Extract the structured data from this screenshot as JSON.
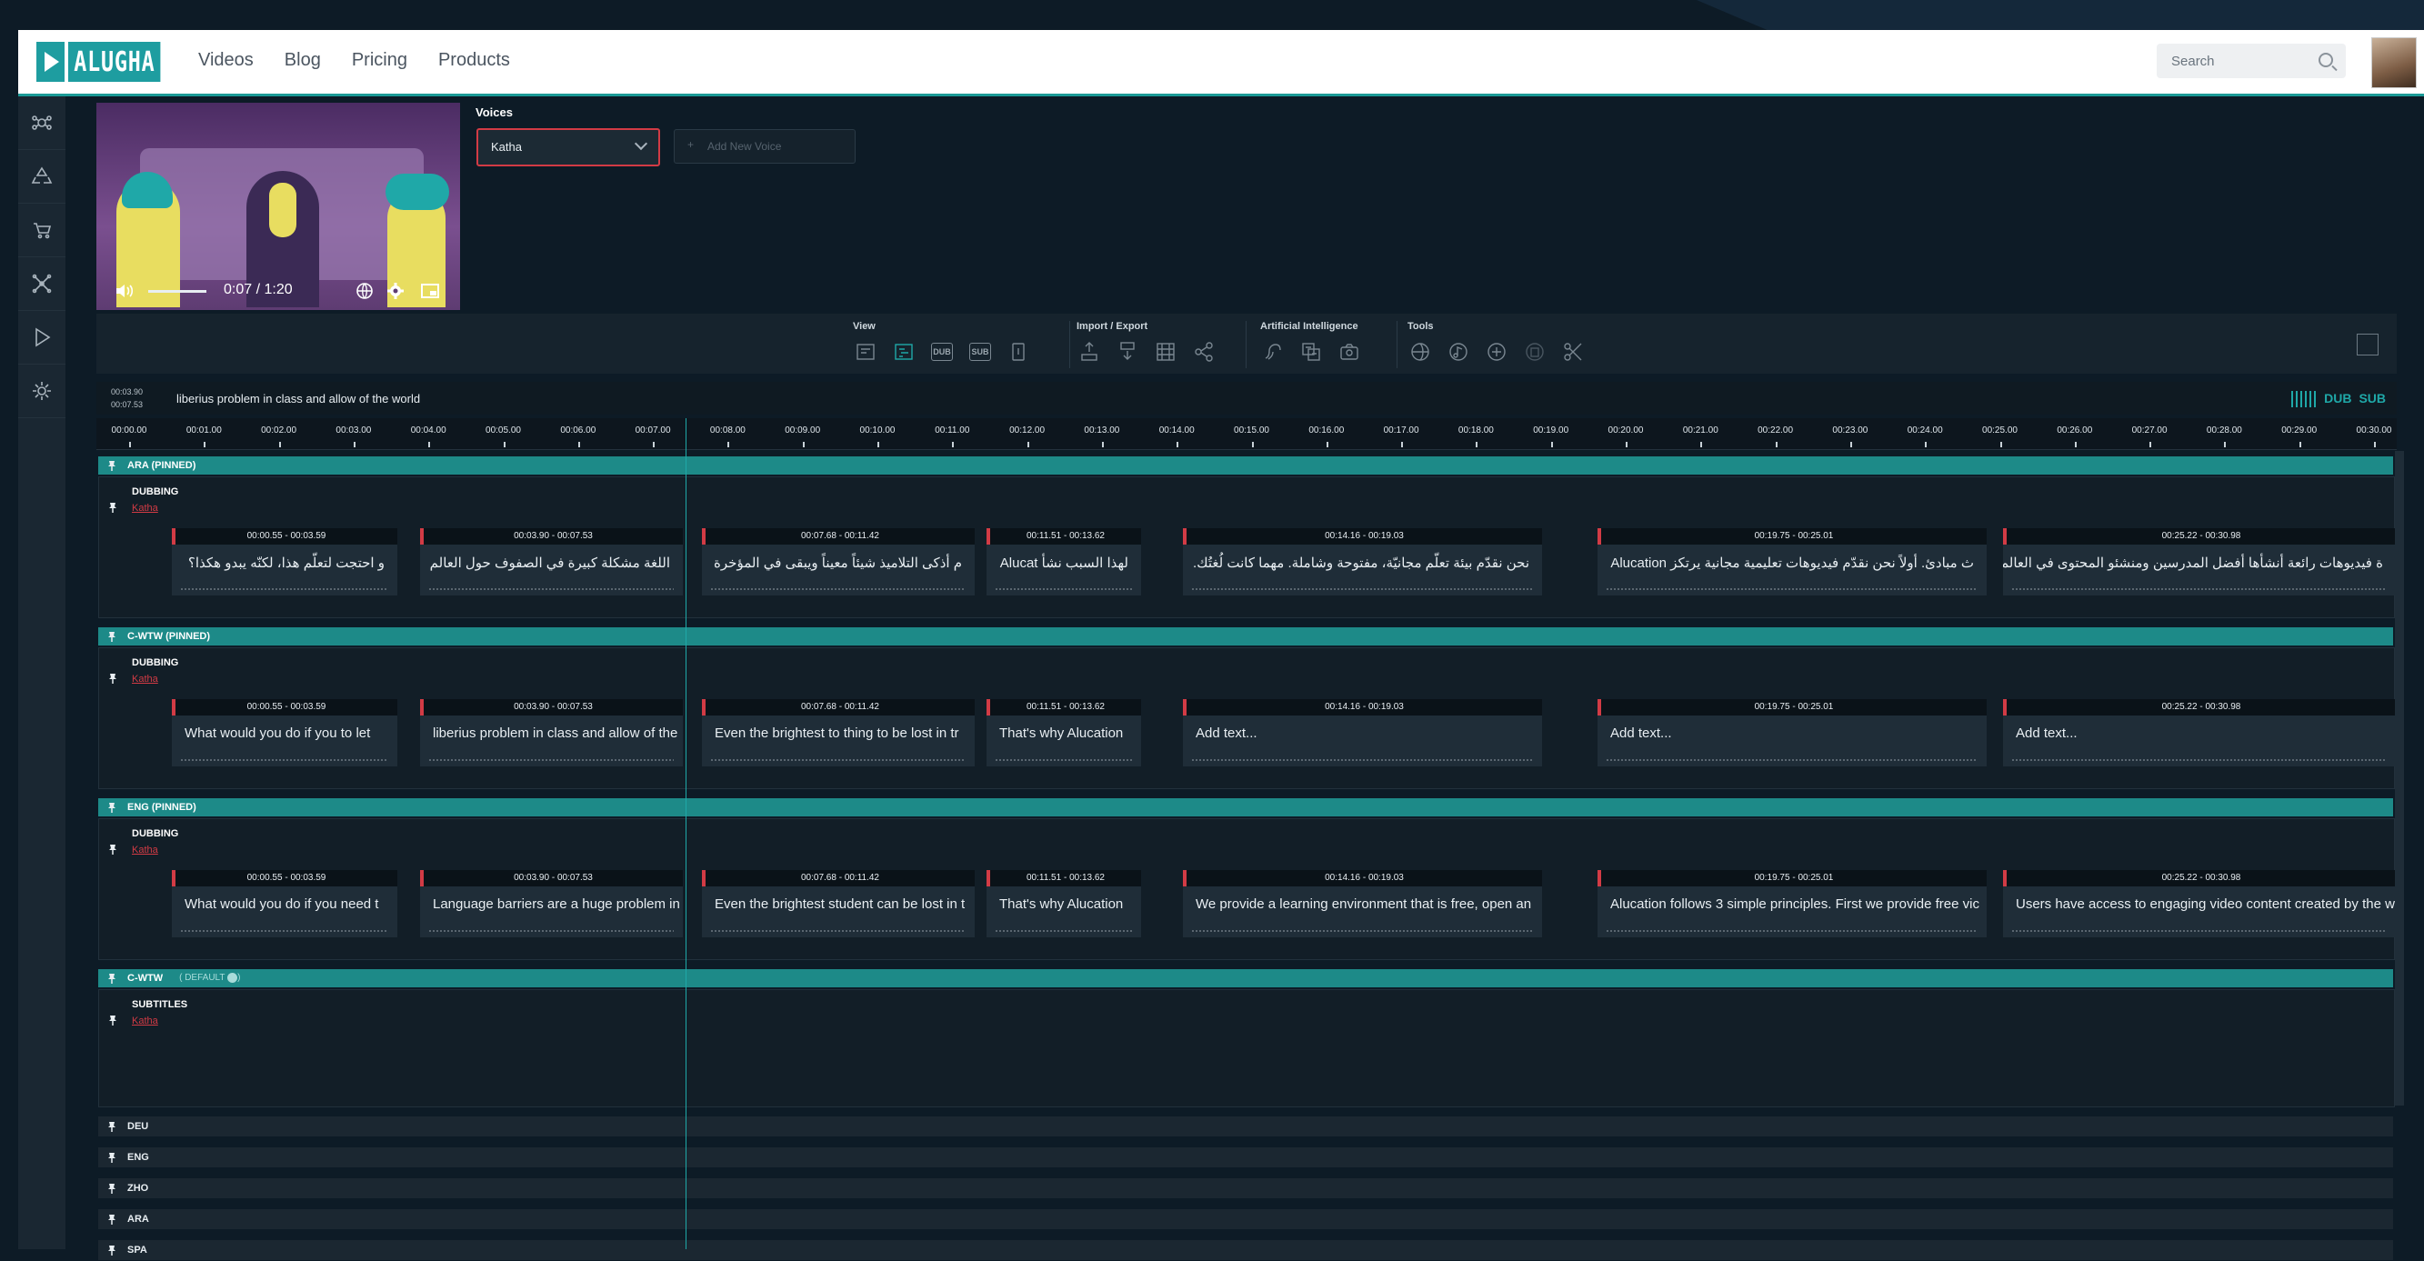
{
  "header": {
    "logo_text": "ALUGHA",
    "nav": [
      "Videos",
      "Blog",
      "Pricing",
      "Products"
    ],
    "search_placeholder": "Search"
  },
  "sidebar": {
    "items": [
      "network-alt-icon",
      "recycle-icon",
      "cart-icon",
      "nodes-icon",
      "play-icon",
      "gear-icon"
    ]
  },
  "video": {
    "time": "0:07 / 1:20"
  },
  "voices": {
    "title": "Voices",
    "selected": "Katha",
    "add_plus": "+",
    "add_label": "Add New Voice"
  },
  "toolbar": {
    "groups": [
      {
        "title": "View",
        "icons": [
          "layout-icon",
          "waveform-view-icon",
          "dub-icon",
          "sub-icon",
          "info-icon"
        ],
        "icon_labels": [
          "",
          "",
          "DUB",
          "SUB",
          ""
        ]
      },
      {
        "title": "Import / Export",
        "icons": [
          "import-icon",
          "sub-download-icon",
          "film-icon",
          "share-icon"
        ]
      },
      {
        "title": "Artificial Intelligence",
        "icons": [
          "ai-voice-icon",
          "ai-translate-icon",
          "ai-camera-icon"
        ]
      },
      {
        "title": "Tools",
        "icons": [
          "globe-tool-icon",
          "music-tool-icon",
          "add-circle-icon",
          "delete-icon",
          "scissors-icon"
        ]
      }
    ]
  },
  "timerow": {
    "start": "00:03.90",
    "end": "00:07.53",
    "text": "liberius problem in class and allow of the world",
    "dub": "DUB",
    "sub": "SUB"
  },
  "ruler": [
    "00:00.00",
    "00:01.00",
    "00:02.00",
    "00:03.00",
    "00:04.00",
    "00:05.00",
    "00:06.00",
    "00:07.00",
    "00:08.00",
    "00:09.00",
    "00:10.00",
    "00:11.00",
    "00:12.00",
    "00:13.00",
    "00:14.00",
    "00:15.00",
    "00:16.00",
    "00:17.00",
    "00:18.00",
    "00:19.00",
    "00:20.00",
    "00:21.00",
    "00:22.00",
    "00:23.00",
    "00:24.00",
    "00:25.00",
    "00:26.00",
    "00:27.00",
    "00:28.00",
    "00:29.00",
    "00:30.00"
  ],
  "segment_times": [
    "00:00.55 - 00:03.59",
    "00:03.90 - 00:07.53",
    "00:07.68 - 00:11.42",
    "00:11.51 - 00:13.62",
    "00:14.16 - 00:19.03",
    "00:19.75 - 00:25.01",
    "00:25.22 - 00:30.98"
  ],
  "tracks": [
    {
      "name": "ARA (PINNED)",
      "type": "DUBBING",
      "voice": "Katha",
      "rtl": true,
      "texts": [
        "و احتجت لتعلّم هذا، لكنّه يبدو هكذا؟",
        "اللغة مشكلة كبيرة في الصفوف حول العالم",
        "م أذكى التلاميذ شيئاً معيناً ويبقى في المؤخرة",
        "لهذا السبب نشأ Alucat",
        "نحن نقدّم بيئة تعلّم مجانيّة، مفتوحة وشاملة. مهما كانت لُغتُك.",
        "ث مبادئ. أولاً نحن نقدّم فيديوهات تعليمية مجانية يرتكز Alucation",
        "ة فيديوهات رائعة أنشأها أفضل المدرسين ومنشئو المحتوى في العالم"
      ]
    },
    {
      "name": "C-WTW (PINNED)",
      "type": "DUBBING",
      "voice": "Katha",
      "rtl": false,
      "texts": [
        "What would you do if you to let",
        "liberius problem in class and allow of the",
        "Even the brightest to thing to be lost in tr",
        "That's why Alucation",
        "Add text...",
        "Add text...",
        "Add text..."
      ]
    },
    {
      "name": "ENG (PINNED)",
      "type": "DUBBING",
      "voice": "Katha",
      "rtl": false,
      "texts": [
        "What would you do if you need t",
        "Language barriers are a huge problem in",
        "Even the brightest student can be lost in t",
        "That's why Alucation",
        "We provide a learning environment that is free, open an",
        "Alucation follows 3 simple principles. First we provide free vic",
        "Users have access to engaging video content created by the world"
      ]
    }
  ],
  "subtitle_track": {
    "name": "C-WTW",
    "badge": "( DEFAULT ",
    "badge_end": ")",
    "type": "SUBTITLES",
    "voice": "Katha"
  },
  "mini_tracks": [
    "DEU",
    "ENG",
    "ZHO",
    "ARA",
    "SPA"
  ]
}
